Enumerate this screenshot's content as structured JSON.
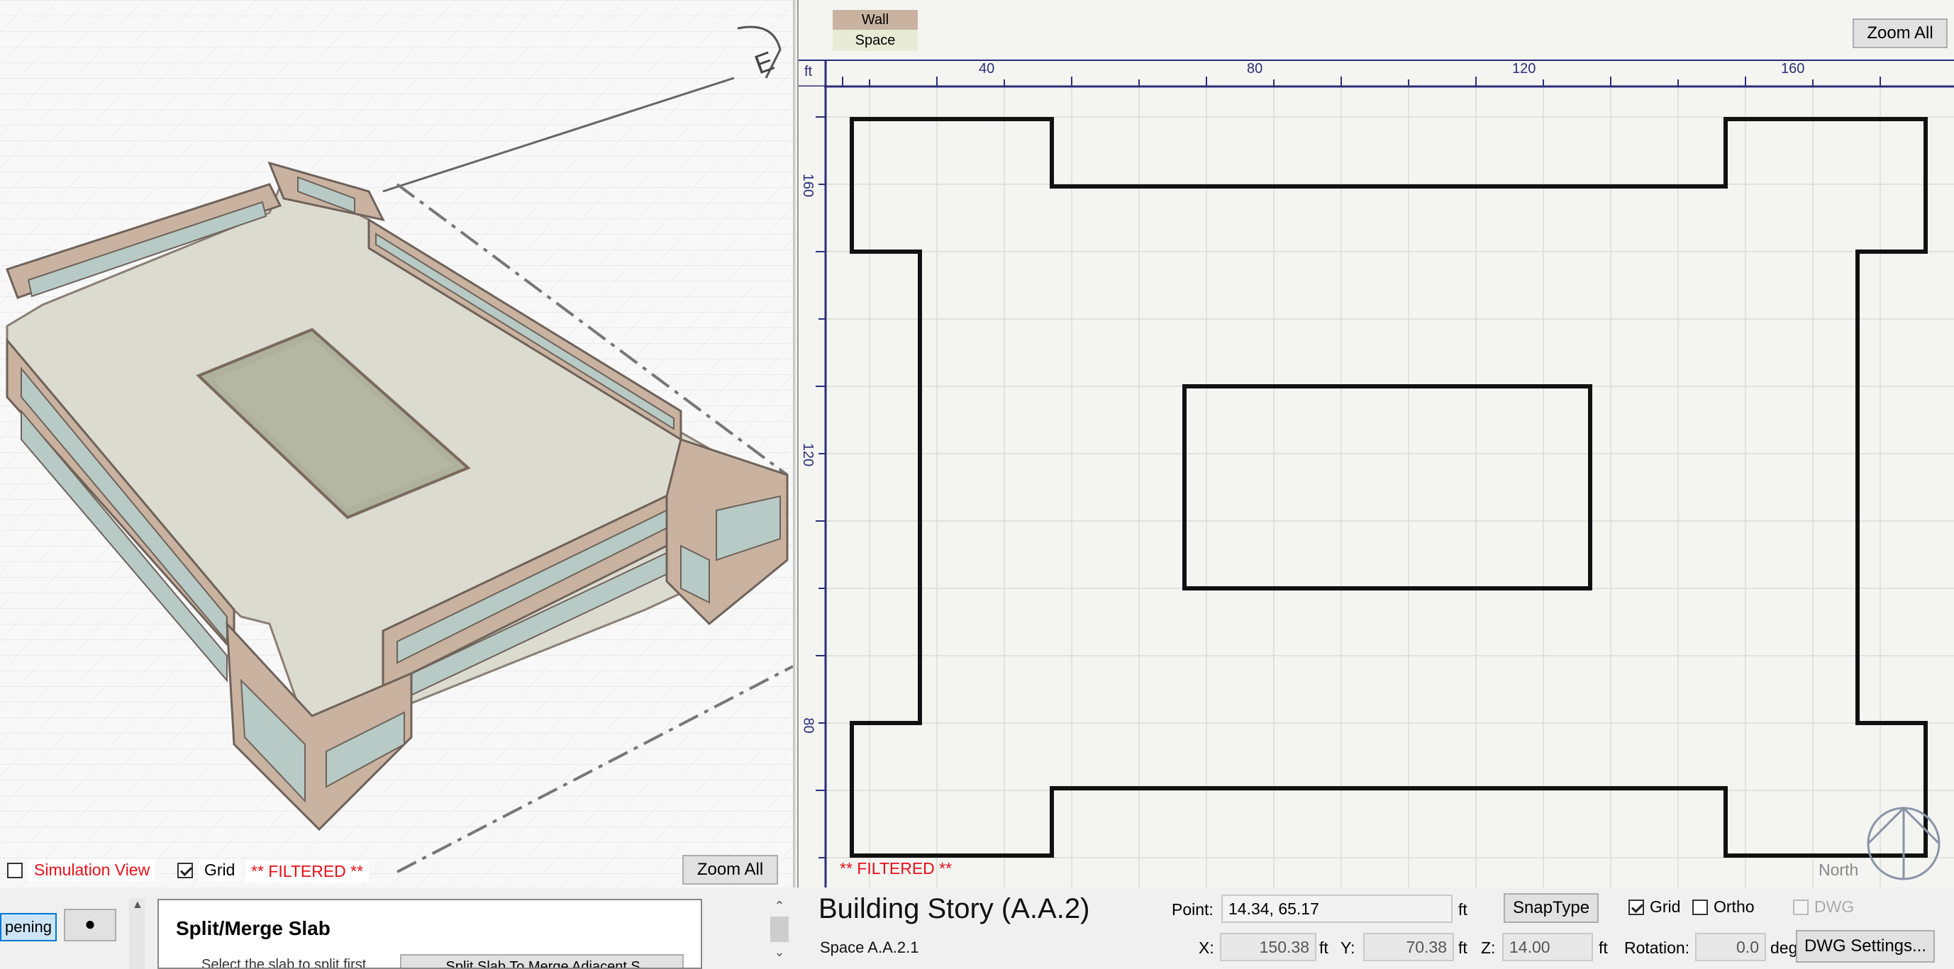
{
  "view3d": {
    "simulation_view_label": "Simulation View",
    "simulation_view_checked": false,
    "grid_label": "Grid",
    "grid_checked": true,
    "filtered_label": "** FILTERED **",
    "zoom_all_label": "Zoom All",
    "compass_label": "E"
  },
  "plan": {
    "legend_wall": "Wall",
    "legend_space": "Space",
    "zoom_all_label": "Zoom All",
    "ruler_unit": "ft",
    "ruler_x_ticks": [
      "40",
      "80",
      "120",
      "160"
    ],
    "ruler_y_ticks": [
      "160",
      "120",
      "80"
    ],
    "filtered_label": "** FILTERED **",
    "north_label": "North"
  },
  "bottom_left": {
    "opening_tab": "pening",
    "panel_title": "Split/Merge Slab",
    "panel_hint": "Select the slab to split first",
    "panel_button": "Split Slab To Merge Adjacent S..."
  },
  "bottom_right": {
    "title": "Building Story (A.A.2)",
    "subtitle": "Space A.A.2.1",
    "point_label": "Point:",
    "point_value": "14.34, 65.17",
    "point_unit": "ft",
    "snaptype_label": "SnapType",
    "grid_label": "Grid",
    "grid_checked": true,
    "ortho_label": "Ortho",
    "ortho_checked": false,
    "dwg_label": "DWG",
    "dwg_checked": false,
    "x_label": "X:",
    "x_value": "150.38",
    "x_unit": "ft",
    "y_label": "Y:",
    "y_value": "70.38",
    "y_unit": "ft",
    "z_label": "Z:",
    "z_value": "14.00",
    "z_unit": "ft",
    "rotation_label": "Rotation:",
    "rotation_value": "0.0",
    "rotation_unit": "deg",
    "dwg_settings_label": "DWG Settings..."
  },
  "colors": {
    "wall": "#c9b3a0",
    "wall_dark": "#7a6a5e",
    "glass": "#b8cac6",
    "floor": "#dcdbd0",
    "courtyard": "#a9ad98",
    "filtered": "#e8101a"
  }
}
